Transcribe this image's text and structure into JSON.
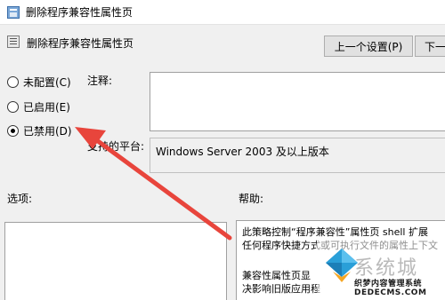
{
  "window": {
    "title": "删除程序兼容性属性页"
  },
  "header": {
    "title": "删除程序兼容性属性页",
    "prev_button": "上一个设置(P)",
    "next_button": "下一"
  },
  "options": [
    {
      "label": "未配置(C)",
      "checked": false
    },
    {
      "label": "已启用(E)",
      "checked": false
    },
    {
      "label": "已禁用(D)",
      "checked": true
    }
  ],
  "labels": {
    "comment": "注释:",
    "platform": "支持的平台:",
    "options": "选项:",
    "help": "帮助:"
  },
  "platform_text": "Windows Server 2003 及以上版本",
  "help_lines": [
    "此策略控制“程序兼容性”属性页 shell 扩展",
    "任何程序快捷方式或可执行文件的属性上下文",
    "兼容性属性页显",
    "决影响旧版应用程"
  ],
  "watermark": {
    "big": "系统城",
    "small": "织梦内容管理系统 DEDECMS.COM"
  },
  "annotation_color": "#e8453c"
}
